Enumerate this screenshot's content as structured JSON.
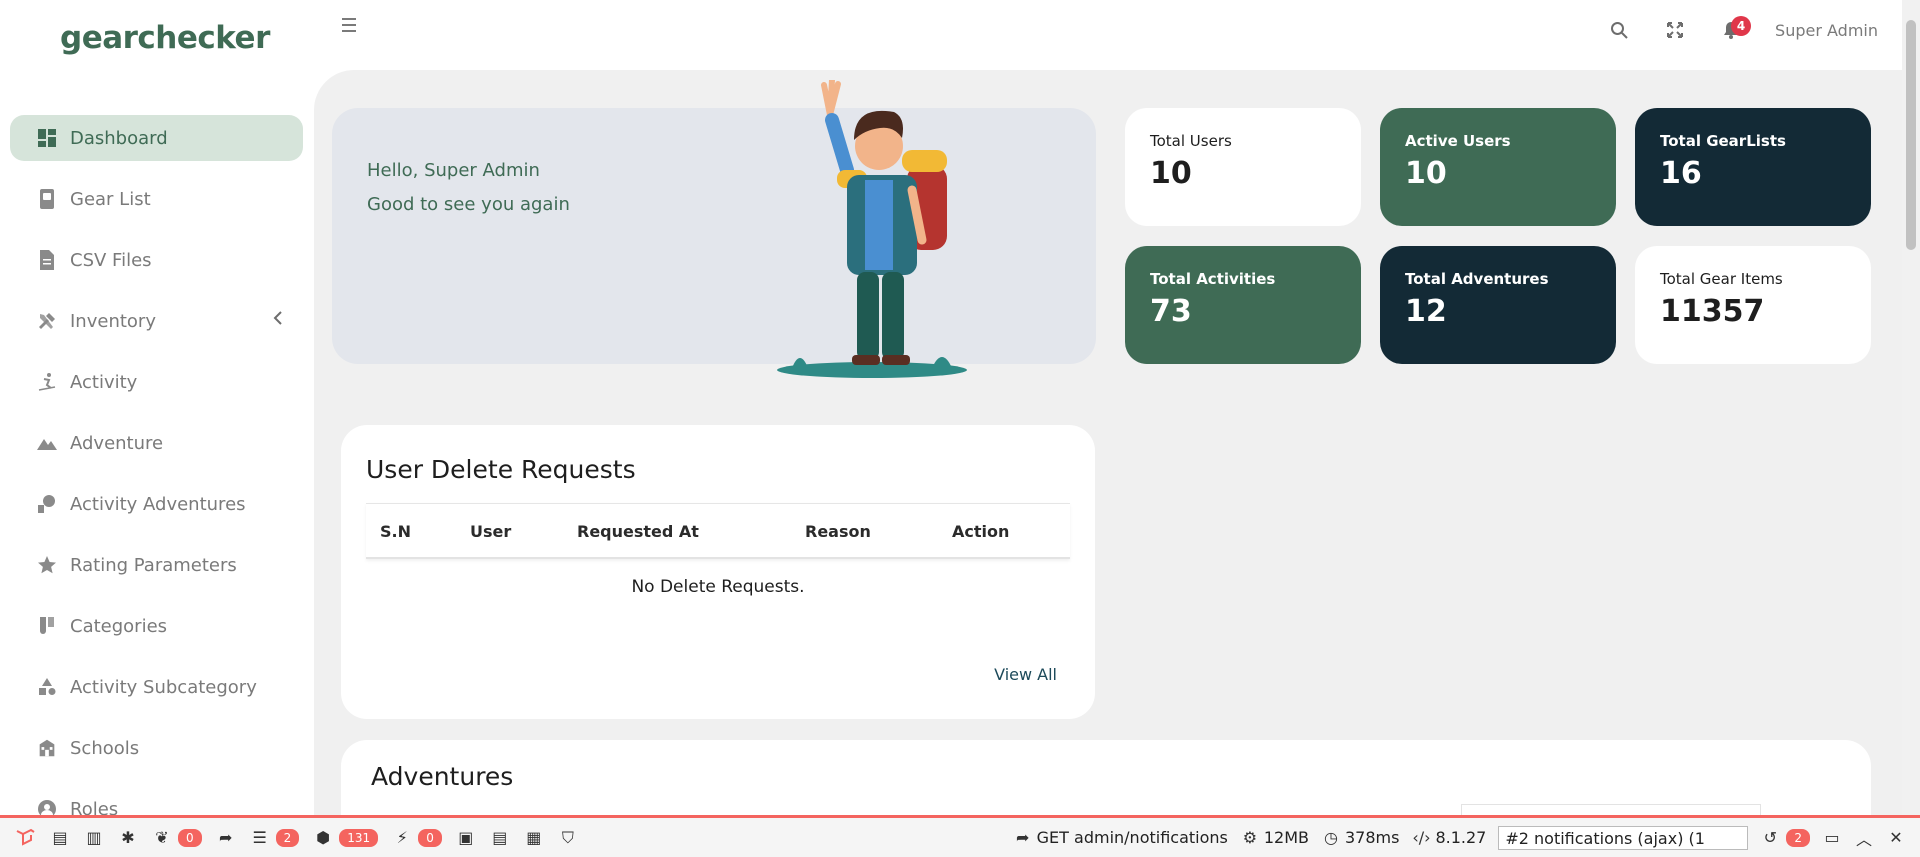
{
  "app": {
    "logo": "gearchecker"
  },
  "sidebar": {
    "items": [
      {
        "label": "Dashboard",
        "icon": "dashboard-icon",
        "active": true
      },
      {
        "label": "Gear List",
        "icon": "gear-list-icon"
      },
      {
        "label": "CSV Files",
        "icon": "file-icon"
      },
      {
        "label": "Inventory",
        "icon": "tools-icon",
        "has_submenu": true
      },
      {
        "label": "Activity",
        "icon": "skier-icon"
      },
      {
        "label": "Adventure",
        "icon": "mountain-icon"
      },
      {
        "label": "Activity Adventures",
        "icon": "activity-adventure-icon"
      },
      {
        "label": "Rating Parameters",
        "icon": "star-icon"
      },
      {
        "label": "Categories",
        "icon": "categories-icon"
      },
      {
        "label": "Activity Subcategory",
        "icon": "shapes-icon"
      },
      {
        "label": "Schools",
        "icon": "school-icon"
      },
      {
        "label": "Roles",
        "icon": "roles-icon"
      }
    ]
  },
  "topbar": {
    "user_name": "Super Admin",
    "notification_count": "4"
  },
  "hero": {
    "greeting": "Hello, Super Admin",
    "subtitle": "Good to see you again"
  },
  "stats": [
    {
      "label": "Total Users",
      "value": "10"
    },
    {
      "label": "Active Users",
      "value": "10"
    },
    {
      "label": "Total GearLists",
      "value": "16"
    },
    {
      "label": "Total Activities",
      "value": "73"
    },
    {
      "label": "Total Adventures",
      "value": "12"
    },
    {
      "label": "Total Gear Items",
      "value": "11357"
    }
  ],
  "delete_requests": {
    "title": "User Delete Requests",
    "columns": [
      "S.N",
      "User",
      "Requested At",
      "Reason",
      "Action"
    ],
    "empty_message": "No Delete Requests.",
    "view_all": "View All"
  },
  "adventures": {
    "title": "Adventures"
  },
  "debugbar": {
    "badges": [
      "0",
      "2",
      "131",
      "0"
    ],
    "request": "GET admin/notifications",
    "memory": "12MB",
    "time": "378ms",
    "version": "8.1.27",
    "selected_request": "#2 notifications (ajax) (1",
    "history_count": "2"
  },
  "colors": {
    "brand_green": "#3f6b55",
    "dark_navy": "#132a36",
    "accent_red": "#e0374a"
  }
}
